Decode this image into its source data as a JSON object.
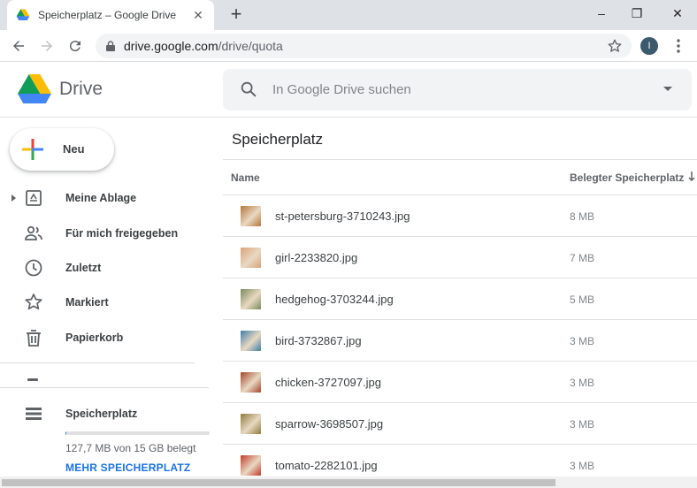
{
  "browser": {
    "tab_title": "Speicherplatz – Google Drive",
    "url_host": "drive.google.com",
    "url_path": "/drive/quota",
    "profile_initial": "I"
  },
  "drive": {
    "app_name": "Drive",
    "search_placeholder": "In Google Drive suchen"
  },
  "sidebar": {
    "new_label": "Neu",
    "items": [
      {
        "label": "Meine Ablage",
        "icon": "my-drive-icon"
      },
      {
        "label": "Für mich freigegeben",
        "icon": "shared-people-icon"
      },
      {
        "label": "Zuletzt",
        "icon": "clock-icon"
      },
      {
        "label": "Markiert",
        "icon": "star-icon"
      },
      {
        "label": "Papierkorb",
        "icon": "trash-icon"
      }
    ],
    "storage_label": "Speicherplatz",
    "quota_fraction": 0.008,
    "quota_text": "127,7 MB von 15 GB belegt",
    "more_storage": "MEHR SPEICHERPLATZ"
  },
  "main": {
    "title": "Speicherplatz",
    "col_name": "Name",
    "col_size": "Belegter Speicherplatz",
    "files": [
      {
        "name": "st-petersburg-3710243.jpg",
        "size": "8 MB"
      },
      {
        "name": "girl-2233820.jpg",
        "size": "7 MB"
      },
      {
        "name": "hedgehog-3703244.jpg",
        "size": "5 MB"
      },
      {
        "name": "bird-3732867.jpg",
        "size": "3 MB"
      },
      {
        "name": "chicken-3727097.jpg",
        "size": "3 MB"
      },
      {
        "name": "sparrow-3698507.jpg",
        "size": "3 MB"
      },
      {
        "name": "tomato-2282101.jpg",
        "size": "3 MB"
      }
    ]
  },
  "colors": {
    "accent": "#1a73e8",
    "thumbs": [
      "#b5763a",
      "#d9a27a",
      "#7a8a5a",
      "#3f7ea8",
      "#a4452a",
      "#8f7a3c",
      "#c23a2a"
    ]
  }
}
